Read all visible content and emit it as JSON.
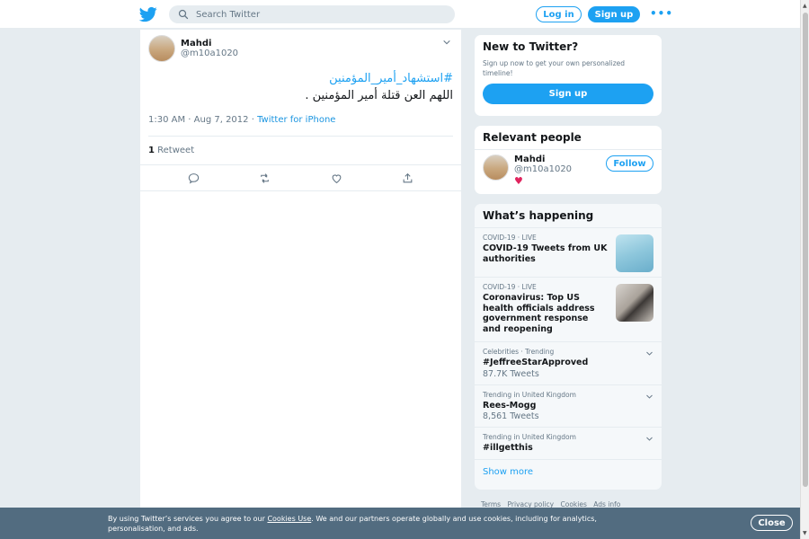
{
  "header": {
    "search_placeholder": "Search Twitter",
    "login_label": "Log in",
    "signup_label": "Sign up",
    "more_label": "•••"
  },
  "tweet": {
    "display_name": "Mahdi",
    "handle": "@m10a1020",
    "hashtag": "#استشهاد_أمير_المؤمنين",
    "text": "اللهم العن قتلة أمير المؤمنين .",
    "timestamp": "1:30 AM · Aug 7, 2012",
    "via_separator": " · ",
    "source": "Twitter for iPhone",
    "retweet_count": "1",
    "retweet_label": "Retweet"
  },
  "new_to_twitter": {
    "title": "New to Twitter?",
    "subtitle": "Sign up now to get your own personalized timeline!",
    "button": "Sign up"
  },
  "relevant_people": {
    "title": "Relevant people",
    "person": {
      "name": "Mahdi",
      "handle": "@m10a1020",
      "bio": "♥",
      "follow_label": "Follow"
    }
  },
  "whats_happening": {
    "title": "What’s happening",
    "trends": [
      {
        "category": "COVID-19 · LIVE",
        "title": "COVID-19 Tweets from UK authorities",
        "count": ""
      },
      {
        "category": "COVID-19 · LIVE",
        "title": "Coronavirus: Top US health officials address government response and reopening",
        "count": ""
      },
      {
        "category": "Celebrities · Trending",
        "title": "#JeffreeStarApproved",
        "count": "87.7K Tweets"
      },
      {
        "category": "Trending in United Kingdom",
        "title": "Rees-Mogg",
        "count": "8,561 Tweets"
      },
      {
        "category": "Trending in United Kingdom",
        "title": "#illgetthis",
        "count": ""
      }
    ],
    "show_more": "Show more"
  },
  "footer": {
    "links": [
      "Terms",
      "Privacy policy",
      "Cookies",
      "Ads info"
    ]
  },
  "cookie_banner": {
    "text_before": "By using Twitter’s services you agree to our ",
    "link": "Cookies Use",
    "text_after": ". We and our partners operate globally and use cookies, including for analytics, personalisation, and ads.",
    "close_label": "Close"
  },
  "colors": {
    "accent": "#1da1f2",
    "background": "#e6ecf0",
    "heart": "#e0245e",
    "cookie_bg": "#526c80"
  }
}
